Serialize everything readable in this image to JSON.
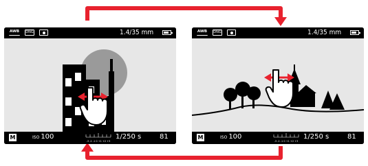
{
  "screens": [
    {
      "status_top": {
        "awb": "AWB",
        "dng": "DNG",
        "lens": "1.4/35 mm"
      },
      "status_bottom": {
        "mode": "M",
        "iso_label": "ISO",
        "iso_value": "100",
        "scale": "-3 -2 -1 0 +1 +2 +3",
        "shutter": "1/250 s",
        "count": "81"
      }
    },
    {
      "status_top": {
        "awb": "AWB",
        "dng": "DNG",
        "lens": "1.4/35 mm"
      },
      "status_bottom": {
        "mode": "M",
        "iso_label": "ISO",
        "iso_value": "100",
        "scale": "-3 -2 -1 0 +1 +2 +3",
        "shutter": "1/250 s",
        "count": "81"
      }
    }
  ],
  "colors": {
    "arrow": "#e8222e",
    "screen": "#000000",
    "scene": "#e7e7e7",
    "sun": "#9a9a9a"
  },
  "icons": [
    "swipe-hand-icon",
    "double-arrow-icon",
    "white-balance-icon",
    "dng-icon",
    "metering-icon",
    "battery-icon"
  ]
}
